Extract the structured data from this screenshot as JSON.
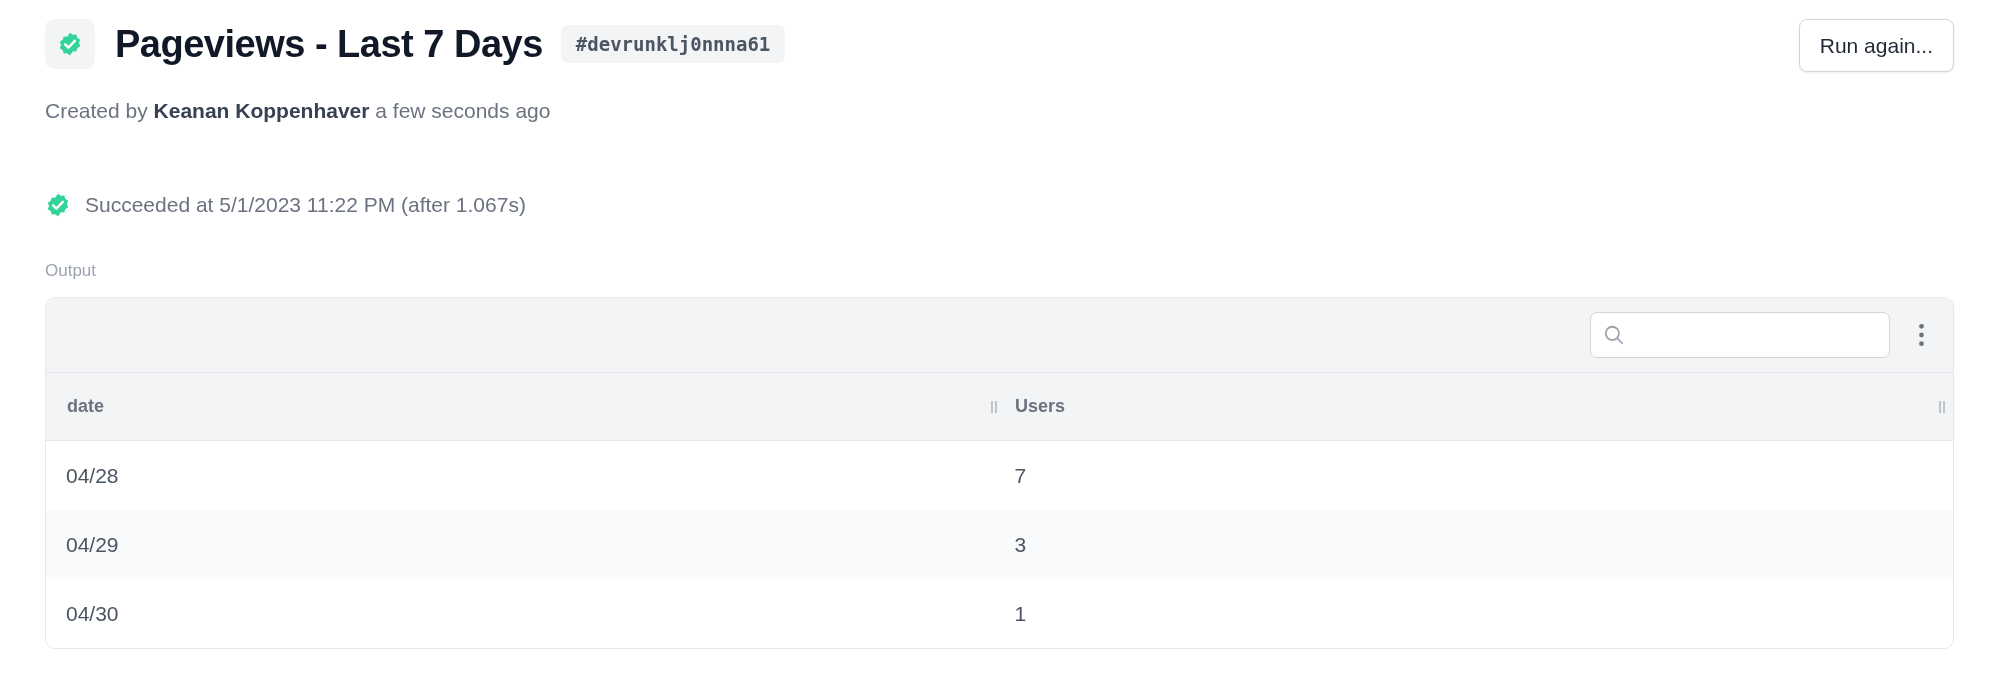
{
  "header": {
    "title": "Pageviews - Last 7 Days",
    "run_id": "#devrunklj0nnna61",
    "button": "Run again..."
  },
  "meta": {
    "prefix": "Created by",
    "author": "Keanan Koppenhaver",
    "suffix": "a few seconds ago"
  },
  "status": {
    "kind": "success",
    "text": "Succeeded at 5/1/2023 11:22 PM (after 1.067s)"
  },
  "output": {
    "label": "Output",
    "table": {
      "columns": [
        "date",
        "Users"
      ],
      "rows": [
        [
          "04/28",
          "7"
        ],
        [
          "04/29",
          "3"
        ],
        [
          "04/30",
          "1"
        ]
      ]
    }
  }
}
